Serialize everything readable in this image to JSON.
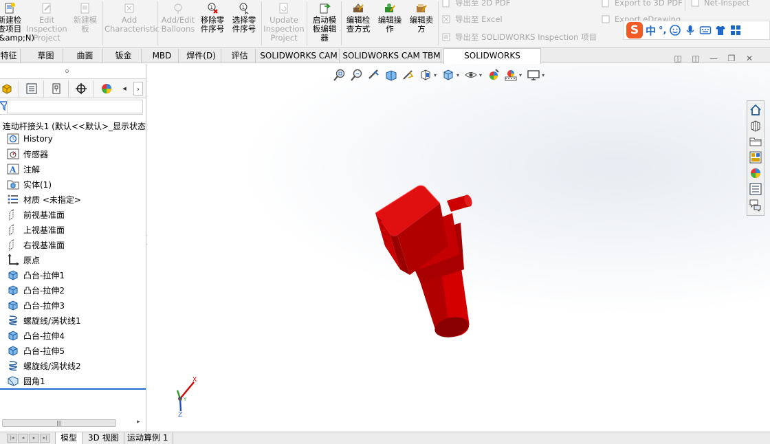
{
  "ribbon": {
    "buttons": [
      {
        "id": "new-project",
        "label": "新建检\n查项目\n(&amp;N)",
        "enabled": true
      },
      {
        "id": "edit-project",
        "label": "Edit\nInspection\nProject",
        "enabled": false
      },
      {
        "id": "new-template",
        "label": "新建模\n板",
        "enabled": false
      },
      {
        "id": "add-char",
        "label": "Add\nCharacteristic",
        "enabled": false
      },
      {
        "id": "add-edit-balloons",
        "label": "Add/Edit\nBalloons",
        "enabled": false
      },
      {
        "id": "remove-part-seq",
        "label": "移除零\n件序号",
        "enabled": true
      },
      {
        "id": "select-part-seq",
        "label": "选择零\n件序号",
        "enabled": true
      },
      {
        "id": "update-project",
        "label": "Update\nInspection\nProject",
        "enabled": false
      },
      {
        "id": "launch-template-editor",
        "label": "启动模\n板编辑\n器",
        "enabled": true
      },
      {
        "id": "edit-inspection-method",
        "label": "编辑检\n查方式",
        "enabled": true
      },
      {
        "id": "edit-operation",
        "label": "编辑操\n作",
        "enabled": true
      },
      {
        "id": "edit-vendor",
        "label": "编辑卖\n方",
        "enabled": true
      }
    ],
    "export_rows": [
      {
        "id": "export-2d-pdf",
        "label": "导出至 2D PDF"
      },
      {
        "id": "export-excel",
        "label": "导出至 Excel"
      },
      {
        "id": "export-sw-project",
        "label": "导出至 SOLIDWORKS Inspection 项目"
      }
    ],
    "right_rows": [
      {
        "id": "export-3d-pdf",
        "label": "Export to 3D PDF"
      },
      {
        "id": "export-edrawing",
        "label": "Export eDrawing"
      },
      {
        "id": "net-inspect",
        "label": "Net-Inspect"
      }
    ]
  },
  "ime": {
    "logo": "S",
    "mode": "中",
    "punct": "°,"
  },
  "tabs": [
    {
      "label": "特征"
    },
    {
      "label": "草图"
    },
    {
      "label": "曲面"
    },
    {
      "label": "钣金"
    },
    {
      "label": "MBD"
    },
    {
      "label": "焊件(D)"
    },
    {
      "label": "评估"
    },
    {
      "label": "SOLIDWORKS CAM"
    },
    {
      "label": "SOLIDWORKS CAM TBM"
    },
    {
      "label": "SOLIDWORKS Inspection",
      "active": true
    }
  ],
  "tree": {
    "root": "连动杆接头1 (默认<<默认>_显示状态",
    "nodes": [
      {
        "label": "History",
        "icon": "history-icon"
      },
      {
        "label": "传感器",
        "icon": "sensor-icon"
      },
      {
        "label": "注解",
        "icon": "annotation-icon"
      },
      {
        "label": "实体(1)",
        "icon": "solid-bodies-icon"
      },
      {
        "label": "材质 <未指定>",
        "icon": "material-icon"
      },
      {
        "label": "前视基准面",
        "icon": "plane-icon"
      },
      {
        "label": "上视基准面",
        "icon": "plane-icon"
      },
      {
        "label": "右视基准面",
        "icon": "plane-icon"
      },
      {
        "label": "原点",
        "icon": "origin-icon"
      },
      {
        "label": "凸台-拉伸1",
        "icon": "extrude-icon"
      },
      {
        "label": "凸台-拉伸2",
        "icon": "extrude-icon"
      },
      {
        "label": "凸台-拉伸3",
        "icon": "extrude-icon"
      },
      {
        "label": "螺旋线/涡状线1",
        "icon": "helix-icon"
      },
      {
        "label": "凸台-拉伸4",
        "icon": "extrude-icon"
      },
      {
        "label": "凸台-拉伸5",
        "icon": "extrude-icon"
      },
      {
        "label": "螺旋线/涡状线2",
        "icon": "helix-icon"
      },
      {
        "label": "圆角1",
        "icon": "fillet-icon"
      }
    ]
  },
  "triad": {
    "x": "X",
    "y": "Y",
    "z": "Z"
  },
  "bottom_tabs": [
    {
      "label": "模型",
      "active": true
    },
    {
      "label": "3D 视图"
    },
    {
      "label": "运动算例 1"
    }
  ],
  "colors": {
    "model": "#d40000",
    "accent": "#1f6bd1"
  }
}
